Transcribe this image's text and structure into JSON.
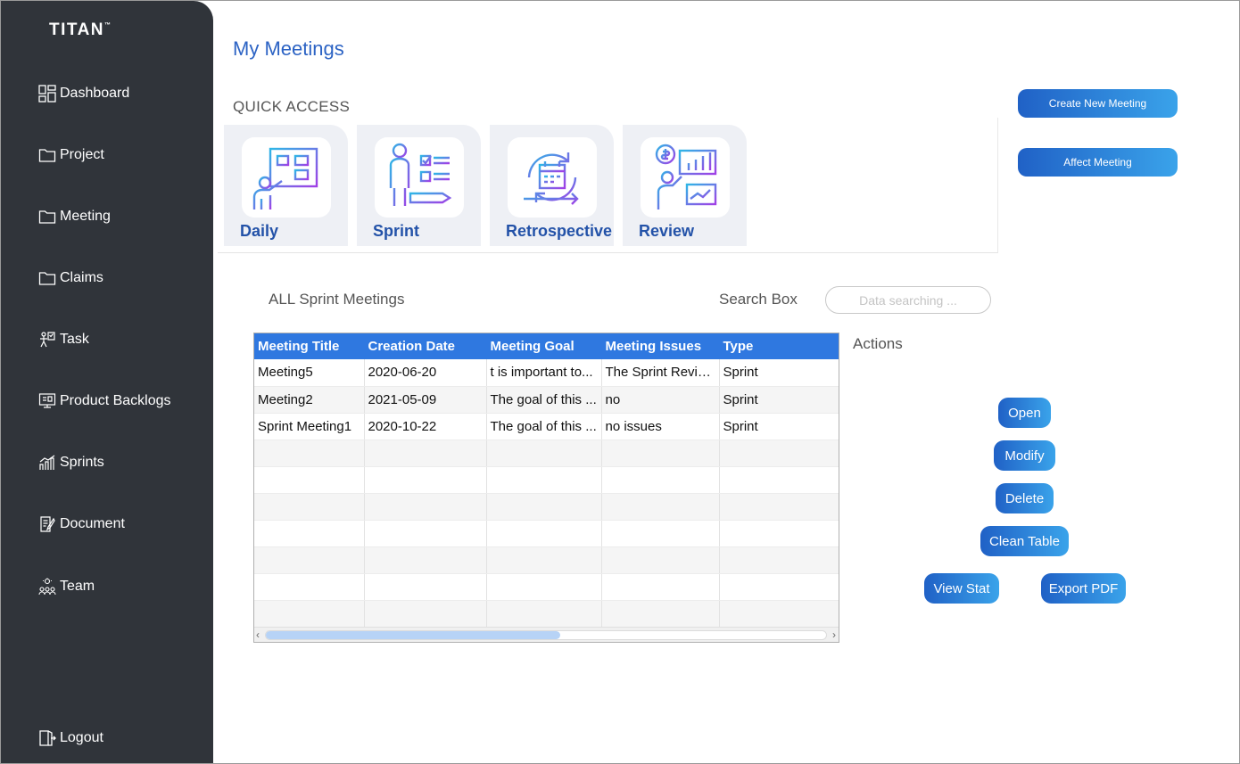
{
  "brand": {
    "name": "TITAN",
    "mark": "™"
  },
  "sidebar": {
    "items": [
      {
        "label": "Dashboard",
        "icon": "dashboard-icon"
      },
      {
        "label": "Project",
        "icon": "folder-icon"
      },
      {
        "label": "Meeting",
        "icon": "folder-icon"
      },
      {
        "label": "Claims",
        "icon": "folder-icon"
      },
      {
        "label": "Task",
        "icon": "task-icon"
      },
      {
        "label": "Product Backlogs",
        "icon": "backlog-icon"
      },
      {
        "label": "Sprints",
        "icon": "sprints-chart-icon"
      },
      {
        "label": "Document",
        "icon": "document-icon"
      },
      {
        "label": "Team",
        "icon": "team-icon"
      }
    ],
    "logout": {
      "label": "Logout",
      "icon": "logout-icon"
    }
  },
  "header": {
    "title": "My Meetings",
    "quick_access": "QUICK ACCESS"
  },
  "quick_access": [
    {
      "label": "Daily",
      "icon": "daily-board-icon"
    },
    {
      "label": "Sprint",
      "icon": "sprint-checklist-icon"
    },
    {
      "label": "Retrospective",
      "icon": "retrospective-calendar-icon"
    },
    {
      "label": "Review",
      "icon": "review-presentation-icon"
    }
  ],
  "buttons": {
    "create": "Create New Meeting",
    "affect": "Affect Meeting"
  },
  "table_section": {
    "title": "ALL Sprint Meetings",
    "search_label": "Search Box",
    "search_placeholder": "Data searching ...",
    "columns": [
      "Meeting Title",
      "Creation Date",
      "Meeting Goal",
      "Meeting Issues",
      "Type"
    ],
    "rows": [
      [
        "Meeting5",
        "2020-06-20",
        "t is important to...",
        "The Sprint Revie...",
        "Sprint"
      ],
      [
        "Meeting2",
        "2021-05-09",
        "The goal of this ...",
        "no",
        "Sprint"
      ],
      [
        "Sprint Meeting1",
        "2020-10-22",
        "The goal of this ...",
        "no issues",
        "Sprint"
      ]
    ]
  },
  "actions": {
    "title": "Actions",
    "open": "Open",
    "modify": "Modify",
    "delete": "Delete",
    "clean": "Clean Table",
    "view_stat": "View Stat",
    "export_pdf": "Export PDF"
  },
  "colors": {
    "sidebar": "#30343a",
    "accent": "#2f78e0",
    "title": "#2c63c4",
    "gradient_start": "#2061c6",
    "gradient_end": "#3aa3ea"
  }
}
